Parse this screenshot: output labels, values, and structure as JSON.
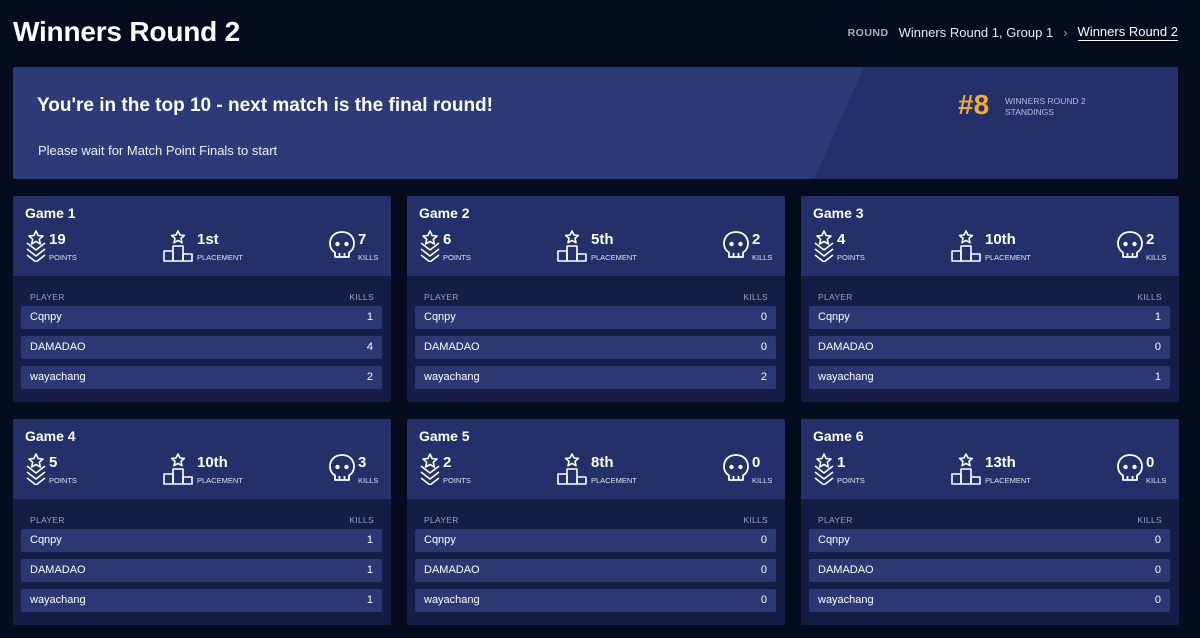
{
  "page": {
    "title": "Winners Round 2"
  },
  "breadcrumb": {
    "label": "ROUND",
    "items": [
      "Winners Round 1, Group 1"
    ],
    "current": "Winners Round 2",
    "separator": "›"
  },
  "banner": {
    "headline": "You're in the top 10 - next match is the final round!",
    "subtext": "Please wait for Match Point Finals to start",
    "rank": "#8",
    "rank_label_line1": "WINNERS ROUND 2",
    "rank_label_line2": "STANDINGS"
  },
  "colors": {
    "background": "#060b1e",
    "banner": "#2c3a78",
    "rank_accent": "#f2a93b",
    "card": "#151d44",
    "card_header": "#243069",
    "row": "#2b3874"
  },
  "icons": {
    "points": "chevron-star-icon",
    "placement": "podium-icon",
    "kills": "skull-icon"
  },
  "labels": {
    "points": "POINTS",
    "placement": "PLACEMENT",
    "kills": "KILLS",
    "player_col": "PLAYER",
    "kills_col": "KILLS"
  },
  "games": [
    {
      "title": "Game 1",
      "points": "19",
      "placement": "1st",
      "kills": "7",
      "players": [
        {
          "name": "Cqnpy",
          "kills": "1"
        },
        {
          "name": "DAMADAO",
          "kills": "4"
        },
        {
          "name": "wayachang",
          "kills": "2"
        }
      ]
    },
    {
      "title": "Game 2",
      "points": "6",
      "placement": "5th",
      "kills": "2",
      "players": [
        {
          "name": "Cqnpy",
          "kills": "0"
        },
        {
          "name": "DAMADAO",
          "kills": "0"
        },
        {
          "name": "wayachang",
          "kills": "2"
        }
      ]
    },
    {
      "title": "Game 3",
      "points": "4",
      "placement": "10th",
      "kills": "2",
      "players": [
        {
          "name": "Cqnpy",
          "kills": "1"
        },
        {
          "name": "DAMADAO",
          "kills": "0"
        },
        {
          "name": "wayachang",
          "kills": "1"
        }
      ]
    },
    {
      "title": "Game 4",
      "points": "5",
      "placement": "10th",
      "kills": "3",
      "players": [
        {
          "name": "Cqnpy",
          "kills": "1"
        },
        {
          "name": "DAMADAO",
          "kills": "1"
        },
        {
          "name": "wayachang",
          "kills": "1"
        }
      ]
    },
    {
      "title": "Game 5",
      "points": "2",
      "placement": "8th",
      "kills": "0",
      "players": [
        {
          "name": "Cqnpy",
          "kills": "0"
        },
        {
          "name": "DAMADAO",
          "kills": "0"
        },
        {
          "name": "wayachang",
          "kills": "0"
        }
      ]
    },
    {
      "title": "Game 6",
      "points": "1",
      "placement": "13th",
      "kills": "0",
      "players": [
        {
          "name": "Cqnpy",
          "kills": "0"
        },
        {
          "name": "DAMADAO",
          "kills": "0"
        },
        {
          "name": "wayachang",
          "kills": "0"
        }
      ]
    }
  ]
}
